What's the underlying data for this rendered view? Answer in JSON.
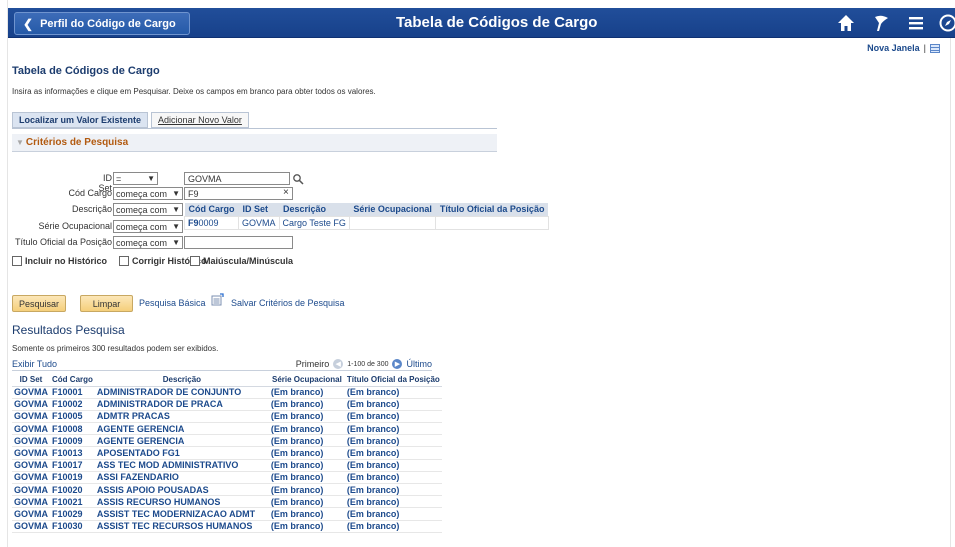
{
  "header": {
    "back_label": "Perfil do Código de Cargo",
    "title": "Tabela de Códigos de Cargo",
    "icons": [
      "home-icon",
      "flag-icon",
      "menu-icon",
      "compass-icon"
    ]
  },
  "new_window": {
    "label": "Nova Janela",
    "separator": "|"
  },
  "page": {
    "title": "Tabela de Códigos de Cargo",
    "instructions": "Insira as informações e clique em Pesquisar. Deixe os campos em branco para obter todos os valores."
  },
  "tabs": [
    {
      "label": "Localizar um Valor Existente"
    },
    {
      "label": "Adicionar Novo Valor"
    }
  ],
  "criteria": {
    "heading": "Critérios de Pesquisa",
    "fields": {
      "id_set": {
        "label": "ID Set",
        "operator": "=",
        "value": "GOVMA"
      },
      "cod_cargo": {
        "label": "Cód Cargo",
        "operator": "começa com",
        "value": "F9"
      },
      "descricao": {
        "label": "Descrição",
        "operator": "começa com",
        "value": ""
      },
      "serie": {
        "label": "Série Ocupacional",
        "operator": "começa com",
        "value": ""
      },
      "titulo": {
        "label": "Título Oficial da Posição",
        "operator": "começa com",
        "value": ""
      }
    },
    "suggestions": {
      "headers": [
        "Cód Cargo",
        "ID Set",
        "Descrição",
        "Série Ocupacional",
        "Título Oficial da Posição"
      ],
      "row": {
        "cod_bold": "F9",
        "cod_rest": "0009",
        "id_set": "GOVMA",
        "descricao": "Cargo Teste FG",
        "serie": "",
        "titulo": ""
      }
    },
    "checkboxes": [
      "Incluir no Histórico",
      "Corrigir Histórico",
      "Maiúscula/Minúscula"
    ]
  },
  "actions": {
    "search": "Pesquisar",
    "clear": "Limpar",
    "basic_search": "Pesquisa Básica",
    "save_criteria": "Salvar Critérios de Pesquisa"
  },
  "results": {
    "title": "Resultados Pesquisa",
    "note": "Somente os primeiros 300 resultados podem ser exibidos.",
    "show_all": "Exibir Tudo",
    "pager": {
      "first": "Primeiro",
      "range": "1-100 de 300",
      "last": "Último"
    },
    "headers": [
      "ID Set",
      "Cód Cargo",
      "Descrição",
      "Série Ocupacional",
      "Título Oficial da Posição"
    ],
    "rows": [
      [
        "GOVMA",
        "F10001",
        "ADMINISTRADOR DE CONJUNTO",
        "(Em branco)",
        "(Em branco)"
      ],
      [
        "GOVMA",
        "F10002",
        "ADMINISTRADOR DE PRACA",
        "(Em branco)",
        "(Em branco)"
      ],
      [
        "GOVMA",
        "F10005",
        "ADMTR PRACAS",
        "(Em branco)",
        "(Em branco)"
      ],
      [
        "GOVMA",
        "F10008",
        "AGENTE GERENCIA",
        "(Em branco)",
        "(Em branco)"
      ],
      [
        "GOVMA",
        "F10009",
        "AGENTE GERENCIA",
        "(Em branco)",
        "(Em branco)"
      ],
      [
        "GOVMA",
        "F10013",
        "APOSENTADO FG1",
        "(Em branco)",
        "(Em branco)"
      ],
      [
        "GOVMA",
        "F10017",
        "ASS TEC MOD ADMINISTRATIVO",
        "(Em branco)",
        "(Em branco)"
      ],
      [
        "GOVMA",
        "F10019",
        "ASSI FAZENDARIO",
        "(Em branco)",
        "(Em branco)"
      ],
      [
        "GOVMA",
        "F10020",
        "ASSIS APOIO POUSADAS",
        "(Em branco)",
        "(Em branco)"
      ],
      [
        "GOVMA",
        "F10021",
        "ASSIS RECURSO HUMANOS",
        "(Em branco)",
        "(Em branco)"
      ],
      [
        "GOVMA",
        "F10029",
        "ASSIST TEC MODERNIZACAO ADMT",
        "(Em branco)",
        "(Em branco)"
      ],
      [
        "GOVMA",
        "F10030",
        "ASSIST TEC RECURSOS HUMANOS",
        "(Em branco)",
        "(Em branco)"
      ]
    ]
  }
}
